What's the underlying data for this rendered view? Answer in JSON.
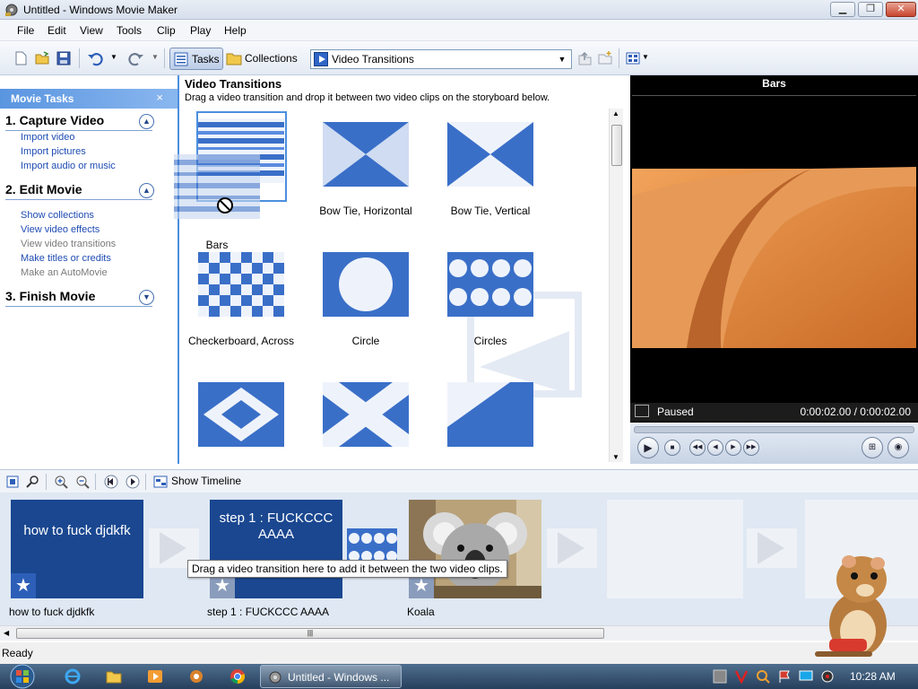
{
  "window": {
    "title": "Untitled - Windows Movie Maker",
    "min": "0",
    "max": "1",
    "close": "r"
  },
  "menu": [
    "File",
    "Edit",
    "View",
    "Tools",
    "Clip",
    "Play",
    "Help"
  ],
  "toolbar": {
    "tasks_label": "Tasks",
    "collections_label": "Collections",
    "collection_selected": "Video Transitions"
  },
  "task_pane": {
    "title": "Movie Tasks",
    "close_glyph": "×",
    "sections": [
      {
        "title": "1. Capture Video",
        "links": [
          "Import video",
          "Import pictures",
          "Import audio or music"
        ]
      },
      {
        "title": "2. Edit Movie",
        "links": [
          "Show collections",
          "View video effects",
          "View video transitions",
          "Make titles or credits",
          "Make an AutoMovie"
        ]
      },
      {
        "title": "3. Finish Movie",
        "links": []
      }
    ]
  },
  "content": {
    "heading": "Video Transitions",
    "instruction": "Drag a video transition and drop it between two video clips on the storyboard below.",
    "transitions": [
      "Bars",
      "Bow Tie, Horizontal",
      "Bow Tie, Vertical",
      "Checkerboard, Across",
      "Circle",
      "Circles"
    ]
  },
  "preview": {
    "title": "Bars",
    "status": "Paused",
    "time": "0:00:02.00 / 0:00:02.00"
  },
  "storyboard": {
    "toolbar_label": "Show Timeline",
    "clips": [
      {
        "title_text": "how to fuck djdkfk",
        "label": "how to fuck djdkfk"
      },
      {
        "title_text": "step 1  : FUCKCCC AAAA",
        "label": "step 1  : FUCKCCC AAAA"
      },
      {
        "title_text": "",
        "label": "Koala"
      }
    ],
    "tooltip": "Drag a video transition here to add it between the two video clips.",
    "scroll_grip": "|||"
  },
  "status_bar": {
    "text": "Ready"
  },
  "taskbar": {
    "window_label": "Untitled - Windows ...",
    "clock": "10:28 AM"
  },
  "colors": {
    "accent": "#4d8fde",
    "storyboard_bg": "#dfe8f3",
    "title_clip": "#1a4790"
  }
}
